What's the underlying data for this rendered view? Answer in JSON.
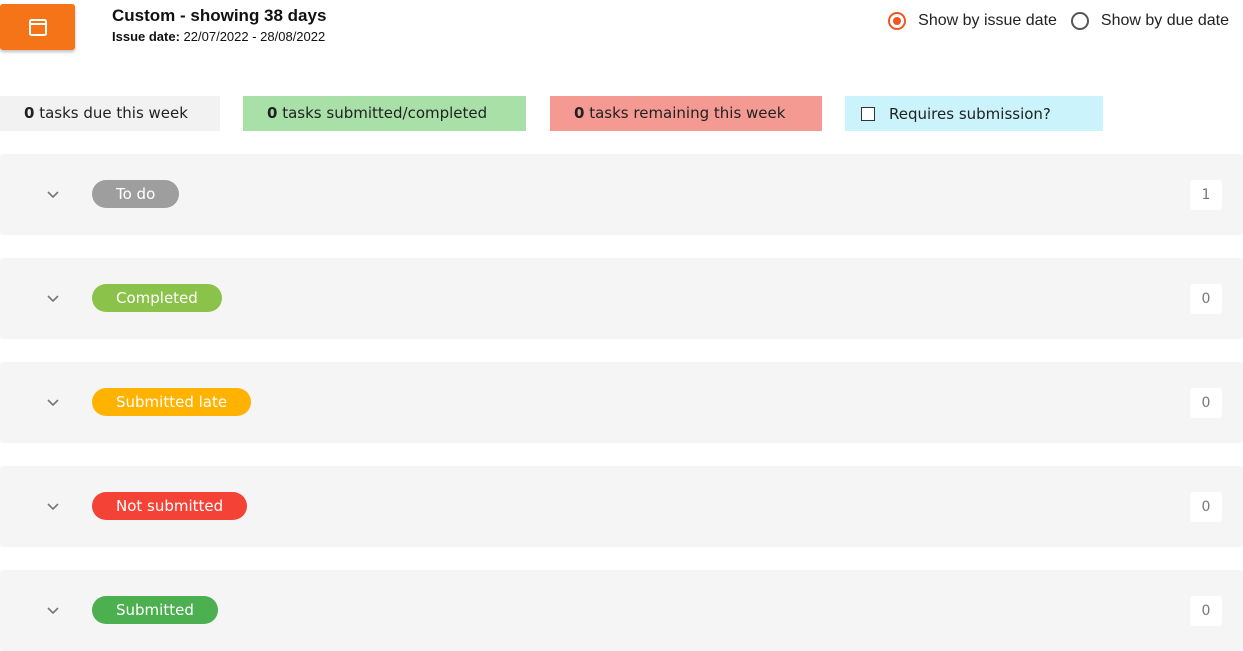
{
  "header": {
    "title": "Custom - showing 38 days",
    "issue_label": "Issue date:",
    "issue_range": "22/07/2022 - 28/08/2022",
    "icon": "calendar-icon",
    "accent": "#f57418"
  },
  "radios": [
    {
      "label": "Show by issue date",
      "checked": true
    },
    {
      "label": "Show by due date",
      "checked": false
    }
  ],
  "stats": {
    "due": {
      "count": "0",
      "label": "tasks due this week"
    },
    "submitted": {
      "count": "0",
      "label": "tasks submitted/completed"
    },
    "remaining": {
      "count": "0",
      "label": "tasks remaining this week"
    },
    "requires_label": "Requires submission?"
  },
  "sections": [
    {
      "label": "To do",
      "count": "1",
      "color": "#9e9e9e"
    },
    {
      "label": "Completed",
      "count": "0",
      "color": "#8bc34a"
    },
    {
      "label": "Submitted late",
      "count": "0",
      "color": "#ffb300"
    },
    {
      "label": "Not submitted",
      "count": "0",
      "color": "#f44336"
    },
    {
      "label": "Submitted",
      "count": "0",
      "color": "#4caf50"
    }
  ]
}
